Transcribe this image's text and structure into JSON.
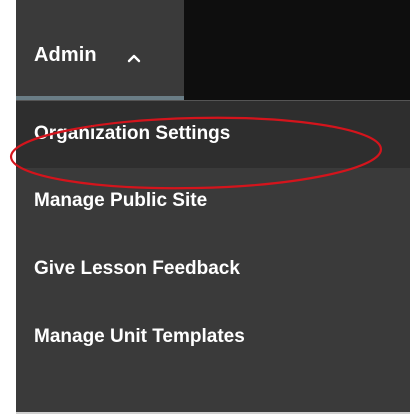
{
  "nav": {
    "admin_label": "Admin",
    "admin_chevron_icon": "chevron-up-icon"
  },
  "menu": {
    "items": [
      {
        "label": "Organization Settings",
        "active": true
      },
      {
        "label": "Manage Public Site",
        "active": false
      },
      {
        "label": "Give Lesson Feedback",
        "active": false
      },
      {
        "label": "Manage Unit Templates",
        "active": false
      }
    ]
  },
  "colors": {
    "topbar": "#0e0e0e",
    "menu_bg": "#3a3a3a",
    "active_bg": "#2e2e2e",
    "tab_underline": "#6a7d86",
    "highlight_ring": "#d4141c"
  }
}
